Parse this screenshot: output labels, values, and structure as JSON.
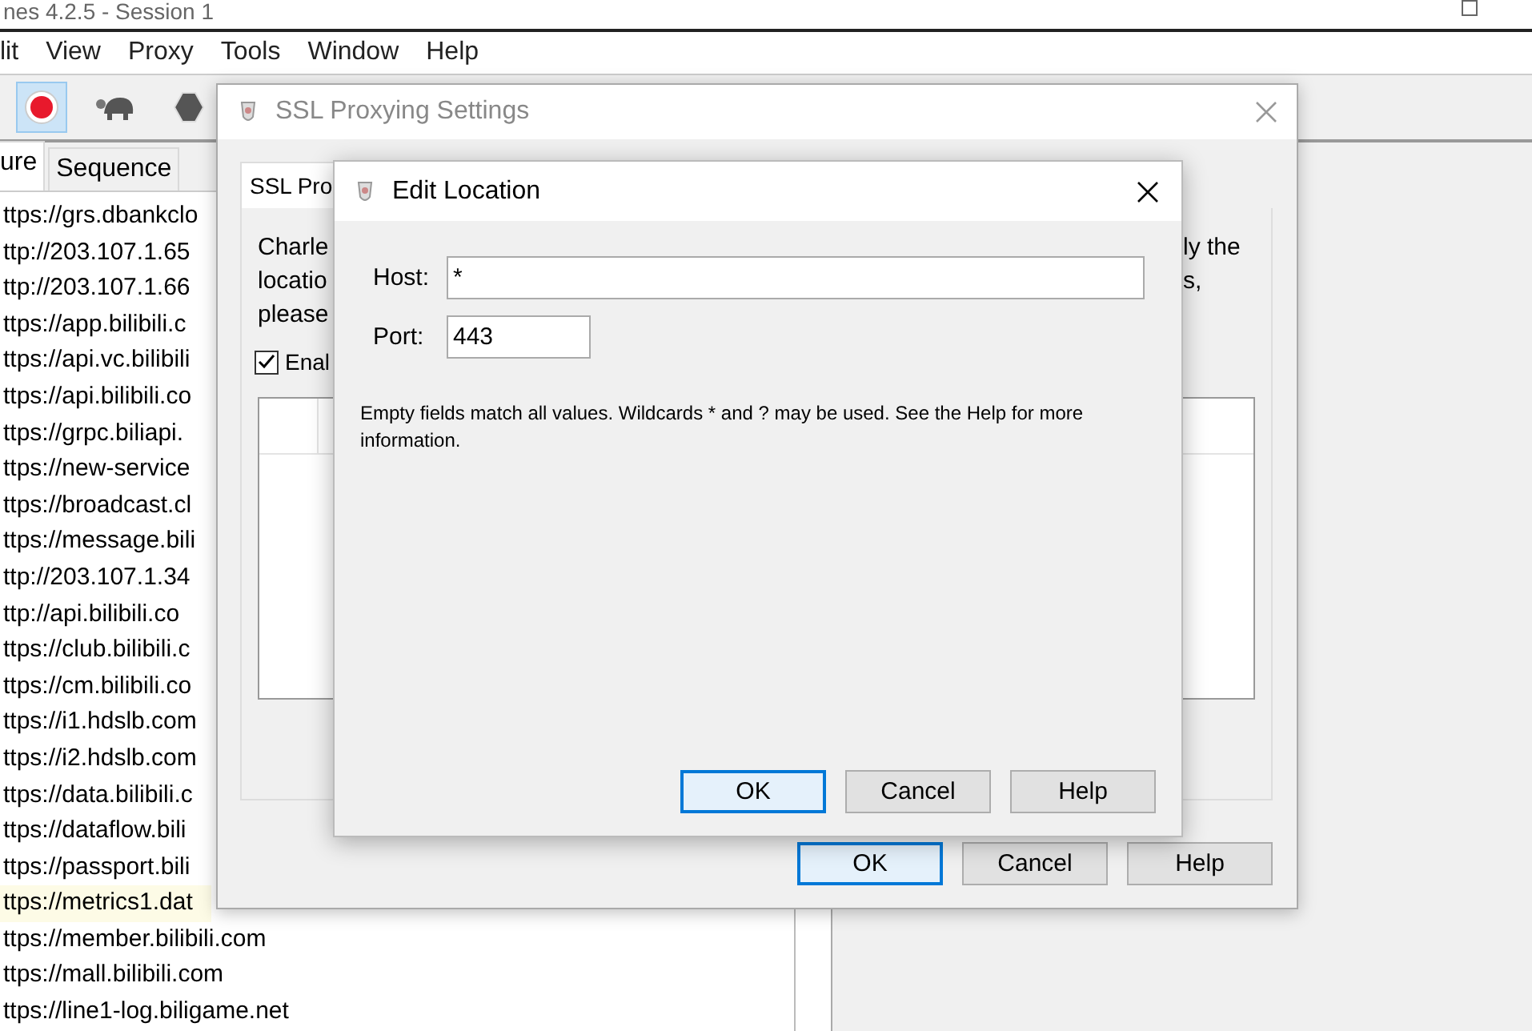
{
  "app": {
    "title": "nes 4.2.5 - Session 1",
    "menu": [
      "lit",
      "View",
      "Proxy",
      "Tools",
      "Window",
      "Help"
    ],
    "toolbar": [
      {
        "kind": "record",
        "selected": true
      },
      {
        "kind": "throttle",
        "selected": false
      },
      {
        "kind": "stop",
        "selected": false
      }
    ],
    "tabs": [
      {
        "label": "ure",
        "selected": true
      },
      {
        "label": "Sequence",
        "selected": false
      }
    ],
    "requests": [
      {
        "url": "ttps://grs.dbankclo",
        "selected": false
      },
      {
        "url": "ttp://203.107.1.65",
        "selected": false
      },
      {
        "url": "ttp://203.107.1.66",
        "selected": false
      },
      {
        "url": "ttps://app.bilibili.c",
        "selected": false
      },
      {
        "url": "ttps://api.vc.bilibili",
        "selected": false
      },
      {
        "url": "ttps://api.bilibili.co",
        "selected": false
      },
      {
        "url": "ttps://grpc.biliapi.",
        "selected": false
      },
      {
        "url": "ttps://new-service",
        "selected": false
      },
      {
        "url": "ttps://broadcast.cl",
        "selected": false
      },
      {
        "url": "ttps://message.bili",
        "selected": false
      },
      {
        "url": "ttp://203.107.1.34",
        "selected": false
      },
      {
        "url": "ttp://api.bilibili.co",
        "selected": false
      },
      {
        "url": "ttps://club.bilibili.c",
        "selected": false
      },
      {
        "url": "ttps://cm.bilibili.co",
        "selected": false
      },
      {
        "url": "ttps://i1.hdslb.com",
        "selected": false
      },
      {
        "url": "ttps://i2.hdslb.com",
        "selected": false
      },
      {
        "url": "ttps://data.bilibili.c",
        "selected": false
      },
      {
        "url": "ttps://dataflow.bili",
        "selected": false
      },
      {
        "url": "ttps://passport.bili",
        "selected": false
      },
      {
        "url": "ttps://metrics1.dat",
        "selected": true
      },
      {
        "url": "ttps://member.bilibili.com",
        "selected": false
      },
      {
        "url": "ttps://mall.bilibili.com",
        "selected": false
      },
      {
        "url": "ttps://line1-log.biligame.net",
        "selected": false
      }
    ]
  },
  "ssl_dialog": {
    "title": "SSL Proxying Settings",
    "active": false,
    "tabs": [
      {
        "label": "SSL Pro",
        "selected": true
      }
    ],
    "text_left": [
      "Charle",
      "locatio",
      "please"
    ],
    "text_right": [
      "ly the",
      "s,"
    ],
    "enable": {
      "label": "Enal",
      "checked": true
    },
    "buttons": [
      {
        "label": "OK",
        "default": true
      },
      {
        "label": "Cancel",
        "default": false
      },
      {
        "label": "Help",
        "default": false
      }
    ]
  },
  "edit_dialog": {
    "title": "Edit Location",
    "active": true,
    "fields": [
      {
        "label": "Host:",
        "value": "*"
      },
      {
        "label": "Port:",
        "value": "443"
      }
    ],
    "hint": "Empty fields match all values. Wildcards * and ? may be used. See the Help for more information.",
    "buttons": [
      {
        "label": "OK",
        "default": true
      },
      {
        "label": "Cancel",
        "default": false
      },
      {
        "label": "Help",
        "default": false
      }
    ]
  }
}
